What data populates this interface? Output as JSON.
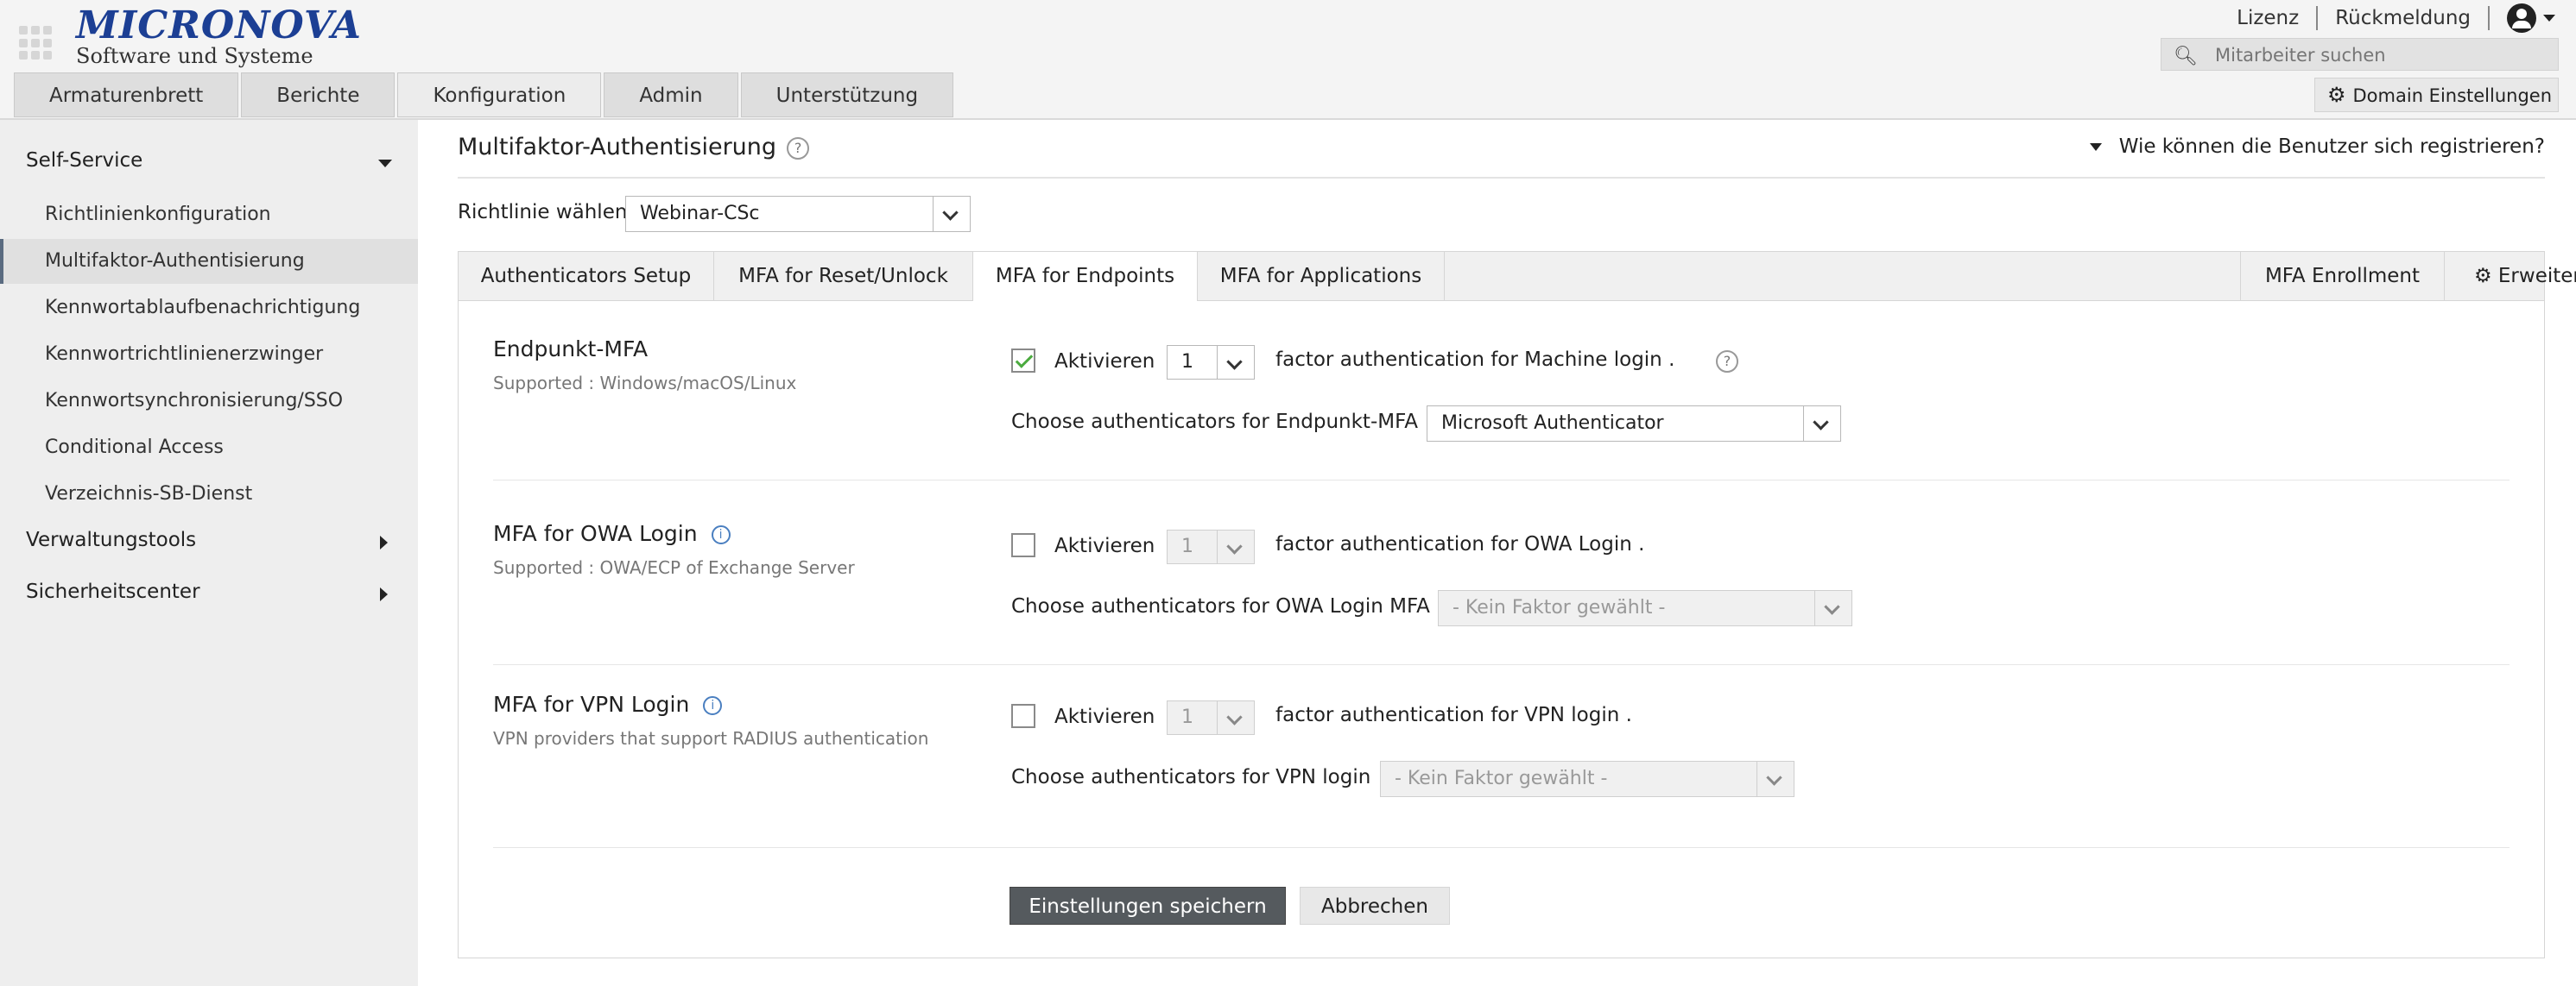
{
  "brand": {
    "name": "MICRONOVA",
    "tagline": "Software und Systeme"
  },
  "top_links": {
    "license": "Lizenz",
    "feedback": "Rückmeldung"
  },
  "search": {
    "placeholder": "Mitarbeiter suchen"
  },
  "domain_settings": "Domain Einstellungen",
  "main_nav": [
    "Armaturenbrett",
    "Berichte",
    "Konfiguration",
    "Admin",
    "Unterstützung"
  ],
  "main_nav_active": "Konfiguration",
  "sidebar": {
    "self_service": "Self-Service",
    "items": [
      "Richtlinienkonfiguration",
      "Multifaktor-Authentisierung",
      "Kennwortablaufbenachrichtigung",
      "Kennwortrichtlinienerzwinger",
      "Kennwortsynchronisierung/SSO",
      "Conditional Access",
      "Verzeichnis-SB-Dienst"
    ],
    "active_item": "Multifaktor-Authentisierung",
    "admin_tools": "Verwaltungstools",
    "security_center": "Sicherheitscenter"
  },
  "page": {
    "title": "Multifaktor-Authentisierung",
    "register_link": "Wie können die Benutzer sich registrieren?",
    "policy_label": "Richtlinie wählen",
    "policy_value": "Webinar-CSc"
  },
  "tabs": {
    "authenticators_setup": "Authenticators Setup",
    "reset_unlock": "MFA for Reset/Unlock",
    "endpoints": "MFA for Endpoints",
    "applications": "MFA for Applications",
    "enrollment": "MFA Enrollment",
    "advanced": "Erweiterte",
    "active": "MFA for Endpoints"
  },
  "sections": [
    {
      "title": "Endpunkt-MFA",
      "subtitle": "Supported : Windows/macOS/Linux",
      "enable_label": "Aktivieren",
      "enabled": true,
      "factor_count": "1",
      "factor_text": "factor authentication for Machine login .",
      "choose_label": "Choose authenticators for Endpunkt-MFA",
      "authenticator": "Microsoft Authenticator"
    },
    {
      "title": "MFA for OWA Login",
      "subtitle": "Supported : OWA/ECP of Exchange Server",
      "enable_label": "Aktivieren",
      "enabled": false,
      "factor_count": "1",
      "factor_text": "factor authentication for OWA Login .",
      "choose_label": "Choose authenticators for OWA Login MFA",
      "authenticator": "- Kein Faktor gewählt -"
    },
    {
      "title": "MFA for VPN Login",
      "subtitle": "VPN providers that support RADIUS authentication",
      "enable_label": "Aktivieren",
      "enabled": false,
      "factor_count": "1",
      "factor_text": "factor authentication for VPN login .",
      "choose_label": "Choose authenticators for VPN login",
      "authenticator": "- Kein Faktor gewählt -"
    }
  ],
  "actions": {
    "save": "Einstellungen speichern",
    "cancel": "Abbrechen"
  },
  "colors": {
    "brand_blue": "#1c3f94",
    "check_green": "#4bab3f",
    "save_button": "#555a5e",
    "sidebar_bg": "#eeeeee"
  }
}
